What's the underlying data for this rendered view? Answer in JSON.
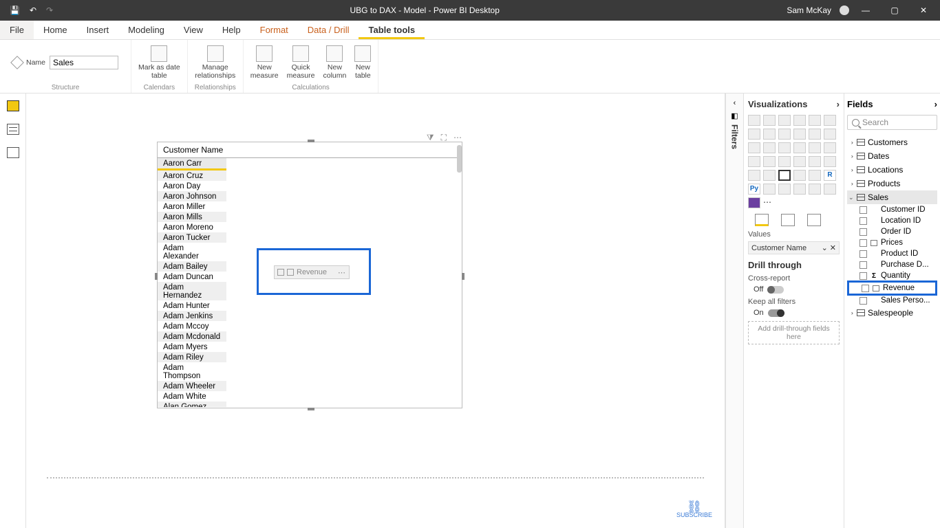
{
  "titlebar": {
    "title": "UBG to DAX - Model - Power BI Desktop",
    "user": "Sam McKay"
  },
  "menubar": {
    "file": "File",
    "tabs": [
      "Home",
      "Insert",
      "Modeling",
      "View",
      "Help",
      "Format",
      "Data / Drill",
      "Table tools"
    ],
    "accent_indices": [
      5,
      6
    ],
    "active_index": 7
  },
  "ribbon": {
    "name_label": "Name",
    "name_value": "Sales",
    "groups": {
      "structure": "Structure",
      "calendars": {
        "label": "Calendars",
        "mark_as_date": "Mark as date\ntable"
      },
      "relationships": {
        "label": "Relationships",
        "manage": "Manage\nrelationships"
      },
      "calculations": {
        "label": "Calculations",
        "new_measure": "New\nmeasure",
        "quick_measure": "Quick\nmeasure",
        "new_column": "New\ncolumn",
        "new_table": "New\ntable"
      }
    }
  },
  "visual": {
    "header": "Customer Name",
    "rows": [
      "Aaron Carr",
      "Aaron Cruz",
      "Aaron Day",
      "Aaron Johnson",
      "Aaron Miller",
      "Aaron Mills",
      "Aaron Moreno",
      "Aaron Tucker",
      "Adam Alexander",
      "Adam Bailey",
      "Adam Duncan",
      "Adam Hernandez",
      "Adam Hunter",
      "Adam Jenkins",
      "Adam Mccoy",
      "Adam Mcdonald",
      "Adam Myers",
      "Adam Riley",
      "Adam Thompson",
      "Adam Wheeler",
      "Adam White",
      "Alan Gomez"
    ]
  },
  "drag_chip": "Revenue",
  "viz_pane": {
    "title": "Visualizations",
    "values_label": "Values",
    "value_field": "Customer Name",
    "drill_through": "Drill through",
    "cross_report": "Cross-report",
    "off": "Off",
    "keep_all_filters": "Keep all filters",
    "on": "On",
    "drop_hint": "Add drill-through fields here"
  },
  "filters_label": "Filters",
  "fields_pane": {
    "title": "Fields",
    "search_placeholder": "Search",
    "tables": [
      "Customers",
      "Dates",
      "Locations",
      "Products",
      "Sales",
      "Salespeople"
    ],
    "sales_fields": [
      {
        "name": "Customer ID",
        "sigma": false
      },
      {
        "name": "Location ID",
        "sigma": false
      },
      {
        "name": "Order ID",
        "sigma": false
      },
      {
        "name": "Prices",
        "sigma": false,
        "icon": true
      },
      {
        "name": "Product ID",
        "sigma": false
      },
      {
        "name": "Purchase D...",
        "sigma": false
      },
      {
        "name": "Quantity",
        "sigma": true
      },
      {
        "name": "Revenue",
        "sigma": false,
        "icon": true,
        "highlighted": true
      },
      {
        "name": "Sales Perso...",
        "sigma": false
      }
    ]
  },
  "subscribe": "SUBSCRIBE"
}
